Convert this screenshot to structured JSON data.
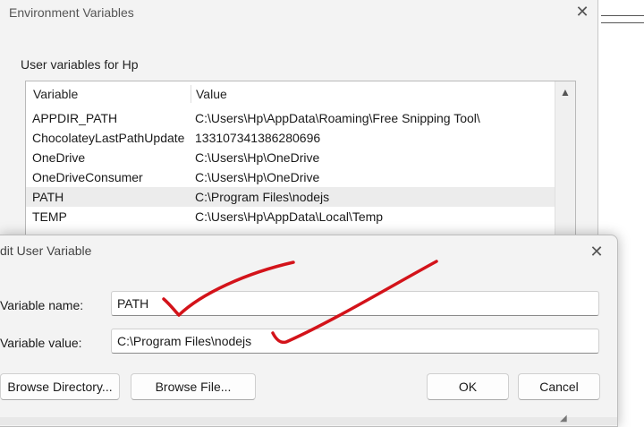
{
  "window": {
    "title": "Environment Variables",
    "close_glyph": "✕",
    "group_label": "User variables for Hp"
  },
  "user_vars": {
    "columns": [
      "Variable",
      "Value"
    ],
    "rows": [
      {
        "name": "APPDIR_PATH",
        "value": "C:\\Users\\Hp\\AppData\\Roaming\\Free Snipping Tool\\"
      },
      {
        "name": "ChocolateyLastPathUpdate",
        "value": "133107341386280696"
      },
      {
        "name": "OneDrive",
        "value": "C:\\Users\\Hp\\OneDrive"
      },
      {
        "name": "OneDriveConsumer",
        "value": "C:\\Users\\Hp\\OneDrive"
      },
      {
        "name": "PATH",
        "value": "C:\\Program Files\\nodejs"
      },
      {
        "name": "TEMP",
        "value": "C:\\Users\\Hp\\AppData\\Local\\Temp"
      }
    ],
    "selected_index": 4,
    "scroll_up_glyph": "▲"
  },
  "dialog": {
    "title": "dit User Variable",
    "close_glyph": "✕",
    "name_label": "Variable name:",
    "name_value": "PATH",
    "value_label": "Variable value:",
    "value_value": "C:\\Program Files\\nodejs",
    "browse_directory": "Browse Directory...",
    "browse_file": "Browse File...",
    "ok": "OK",
    "cancel": "Cancel"
  },
  "colors": {
    "annotation_red": "#d3131a",
    "selected_row": "#ececec"
  }
}
